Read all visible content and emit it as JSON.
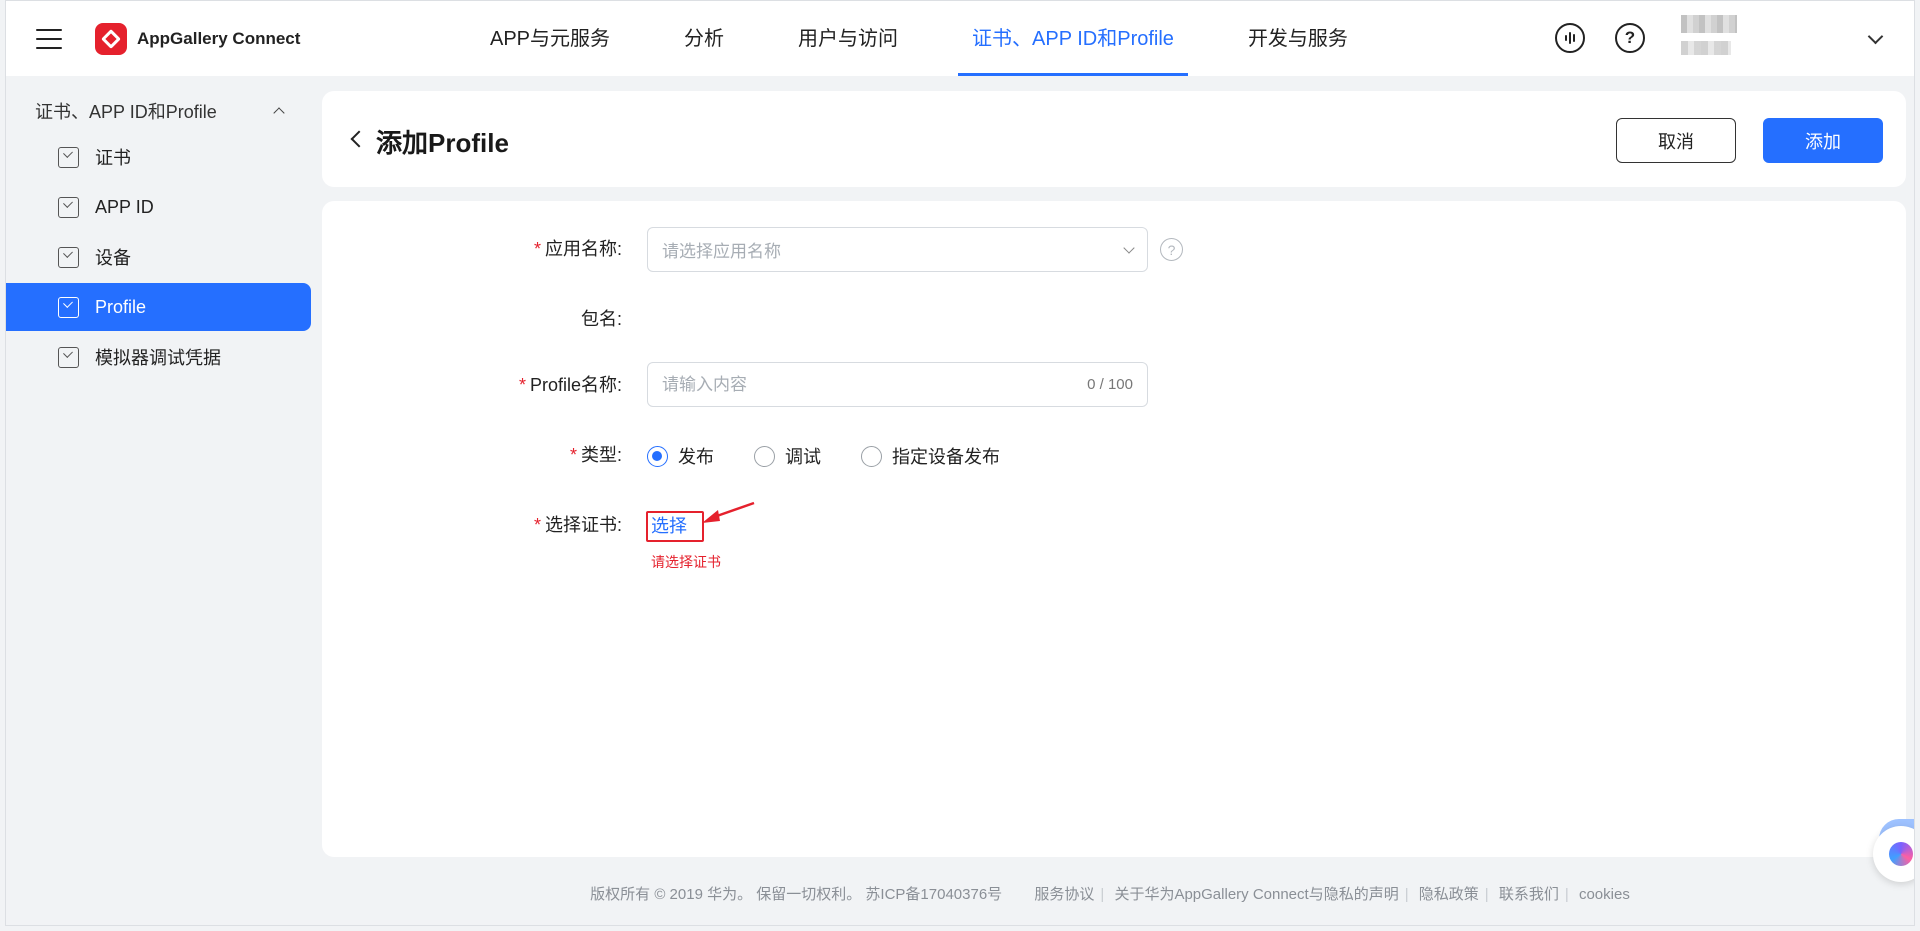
{
  "topbar": {
    "brand_name": "AppGallery Connect",
    "nav": [
      {
        "label": "APP与元服务"
      },
      {
        "label": "分析"
      },
      {
        "label": "用户与访问"
      },
      {
        "label": "证书、APP ID和Profile",
        "active": true
      },
      {
        "label": "开发与服务"
      }
    ],
    "icons": [
      "menu-icon",
      "feedback-icon",
      "help-icon",
      "chevron-down-icon"
    ]
  },
  "sidebar": {
    "group_label": "证书、APP ID和Profile",
    "items": [
      {
        "label": "证书"
      },
      {
        "label": "APP ID"
      },
      {
        "label": "设备"
      },
      {
        "label": "Profile",
        "active": true
      },
      {
        "label": "模拟器调试凭据"
      }
    ]
  },
  "header": {
    "title": "添加Profile",
    "cancel_label": "取消",
    "add_label": "添加"
  },
  "form": {
    "app_name_label": "应用名称:",
    "app_name_placeholder": "请选择应用名称",
    "package_label": "包名:",
    "profile_name_label": "Profile名称:",
    "profile_name_placeholder": "请输入内容",
    "profile_name_counter": "0 / 100",
    "type_label": "类型:",
    "type_options": [
      {
        "label": "发布",
        "checked": true
      },
      {
        "label": "调试",
        "checked": false
      },
      {
        "label": "指定设备发布",
        "checked": false
      }
    ],
    "cert_label": "选择证书:",
    "cert_link": "选择",
    "cert_error": "请选择证书",
    "required_mark": "*"
  },
  "footer": {
    "copyright": "版权所有 © 2019 华为。 保留一切权利。 苏ICP备17040376号",
    "links": [
      "服务协议",
      "关于华为AppGallery Connect与隐私的声明",
      "隐私政策",
      "联系我们",
      "cookies"
    ]
  },
  "colors": {
    "accent": "#256fff",
    "required": "#e5212d",
    "brand": "#e5212d"
  }
}
